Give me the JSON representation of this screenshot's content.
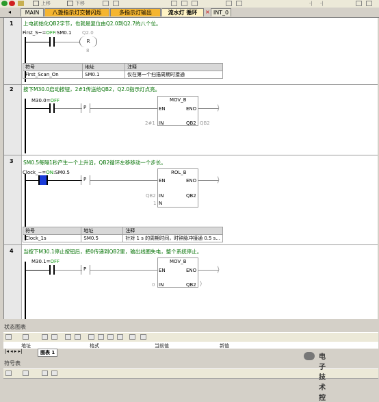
{
  "toolbar": {
    "items": [
      "上移",
      "下移",
      "-|",
      "-|"
    ]
  },
  "tabs": [
    {
      "label": "MAIN"
    },
    {
      "label": "八盏指示灯交替闪烁"
    },
    {
      "label": "多指示灯输出"
    },
    {
      "label": "流水灯 循环"
    },
    {
      "label": "INT_0"
    }
  ],
  "networks": [
    {
      "num": "1",
      "comment": "上电初始化QB2字节，也就是复位由Q2.0到Q2.7的八个位。",
      "contact_label_prefix": "First_S~=",
      "contact_state": "OFF",
      "contact_addr": ":SM0.1",
      "coil_addr": "Q2.0",
      "coil_type": "R",
      "coil_count": "8",
      "symbols": {
        "headers": [
          "符号",
          "地址",
          "注释"
        ],
        "rows": [
          [
            "First_Scan_On",
            "SM0.1",
            "仅在第一个扫描周期时接通"
          ]
        ]
      }
    },
    {
      "num": "2",
      "comment": "按下M30.0启动按钮，2#1传送给QB2，Q2.0指示灯点亮。",
      "contact_label_prefix": "M30.0=",
      "contact_state": "OFF",
      "edge": "P",
      "box_title": "MOV_B",
      "en": "EN",
      "eno": "ENO",
      "in_val": "2#1",
      "in_pin": "IN",
      "out_pin": "OUT",
      "out_val": "QB2",
      "out_right": "QB2"
    },
    {
      "num": "3",
      "comment": "SM0.5每隔1秒产生一个上升沿，QB2循环左移移动一个步长。",
      "contact_label_prefix": "Clock_~=",
      "contact_state": "ON",
      "contact_addr": ":SM0.5",
      "edge": "P",
      "box_title": "ROL_B",
      "en": "EN",
      "eno": "ENO",
      "in_val": "QB2",
      "in_pin": "IN",
      "out_pin": "OUT",
      "out_val": "QB2",
      "n_val": "1",
      "n_pin": "N",
      "symbols": {
        "headers": [
          "符号",
          "地址",
          "注释"
        ],
        "rows": [
          [
            "Clock_1s",
            "SM0.5",
            "针对 1 s 的周期时间，时钟脉冲接通 0.5 s..."
          ]
        ]
      }
    },
    {
      "num": "4",
      "comment": "当按下M30.1停止按钮后，把0传递到QB2里，输出线圈失电，整个系统停止。",
      "contact_label_prefix": "M30.1=",
      "contact_state": "OFF",
      "edge": "P",
      "box_title": "MOV_B",
      "en": "EN",
      "eno": "ENO",
      "in_val": "0",
      "in_pin": "IN",
      "out_pin": "OUT",
      "out_val": "QB2"
    }
  ],
  "status_panel": {
    "title": "状态图表",
    "columns": [
      "地址",
      "格式",
      "当前值",
      "新值"
    ],
    "sheet_tab": "图表 1"
  },
  "symbol_panel": {
    "title": "符号表"
  },
  "watermark": "电子技术控"
}
